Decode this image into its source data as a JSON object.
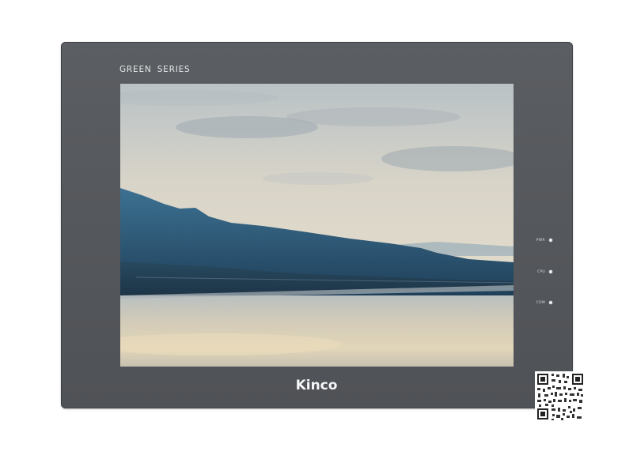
{
  "device": {
    "series_label": "GREEN SERIES",
    "brand": "Kinco",
    "bezel_color": "#55585c",
    "indicators": [
      {
        "label": "PWR",
        "color": "#e8e9ea"
      },
      {
        "label": "CPU",
        "color": "#e8e9ea"
      },
      {
        "label": "COM",
        "color": "#e8e9ea"
      }
    ],
    "screen": {
      "content": "landscape-photo",
      "sky_color": "#d9d3c4",
      "mountain_color": "#2e5a78",
      "water_color": "#cfc6b2"
    },
    "qr_code": "qr-code-icon"
  }
}
